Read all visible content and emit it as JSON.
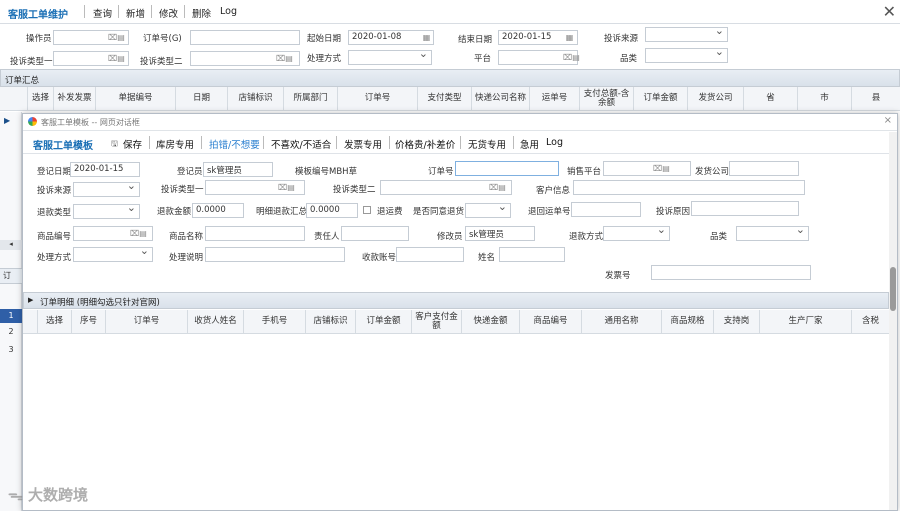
{
  "main": {
    "title": "客服工单维护",
    "buttons": [
      "查询",
      "新增",
      "修改",
      "删除",
      "Log"
    ],
    "close": "✕"
  },
  "filters": {
    "operator": "操作员",
    "order_no": "订单号(G)",
    "start_date": "起始日期",
    "start_value": "2020-01-08",
    "end_date": "结束日期",
    "end_value": "2020-01-15",
    "complaint_source": "投诉来源",
    "complaint_type1": "投诉类型一",
    "complaint_type2": "投诉类型二",
    "handle_method": "处理方式",
    "platform": "平台",
    "category": "品类"
  },
  "summary": {
    "title": "订单汇总",
    "columns": [
      "选择",
      "补发发票",
      "单据编号",
      "日期",
      "店铺标识",
      "所属部门",
      "订单号",
      "支付类型",
      "快递公司名称",
      "运单号",
      "支付总额-含余额",
      "订单金额",
      "发货公司",
      "省",
      "市",
      "县"
    ]
  },
  "dialog": {
    "window_title": "客服工单模板 -- 网页对话框",
    "title": "客服工单模板",
    "save": "保存",
    "tabs": [
      "库房专用",
      "拍错/不想要",
      "不喜欢/不适合",
      "发票专用",
      "价格贵/补差价",
      "无货专用",
      "急用",
      "Log"
    ],
    "active_tab": "拍错/不想要",
    "form": {
      "reg_date": "登记日期",
      "reg_date_value": "2020-01-15",
      "registrar": "登记员",
      "registrar_value": "sk管理员",
      "template_no": "模板编号MBH草",
      "order_no": "订单号",
      "sales_platform": "销售平台",
      "ship_company": "发货公司",
      "complaint_source": "投诉来源",
      "complaint_type1": "投诉类型一",
      "complaint_type2": "投诉类型二",
      "customer_info": "客户信息",
      "refund_type": "退款类型",
      "refund_amount": "退款金额",
      "refund_amount_value": "0.0000",
      "detail_refund_sum": "明细退款汇总",
      "detail_refund_value": "0.0000",
      "refund_freight": "退运费",
      "agree_return": "是否同意退货",
      "return_waybill": "退回运单号",
      "complaint_reason": "投诉原因",
      "product_code": "商品编号",
      "product_name": "商品名称",
      "responsible": "责任人",
      "modifier": "修改员",
      "modifier_value": "sk管理员",
      "refund_method": "退款方式",
      "category": "品类",
      "handle_method": "处理方式",
      "handle_desc": "处理说明",
      "pay_account": "收款账号",
      "name": "姓名",
      "shipping_no": "发票号"
    },
    "details": {
      "title": "订单明细 (明细勾选只针对官网)",
      "columns": [
        "选择",
        "序号",
        "订单号",
        "收货人姓名",
        "手机号",
        "店铺标识",
        "订单金额",
        "客户支付金额",
        "快递金额",
        "商品编号",
        "通用名称",
        "商品规格",
        "支持岗",
        "生产厂家",
        "含税"
      ]
    }
  },
  "left_rows": [
    "1",
    "2",
    "3"
  ],
  "left_header": "订",
  "watermark": "大数跨境"
}
